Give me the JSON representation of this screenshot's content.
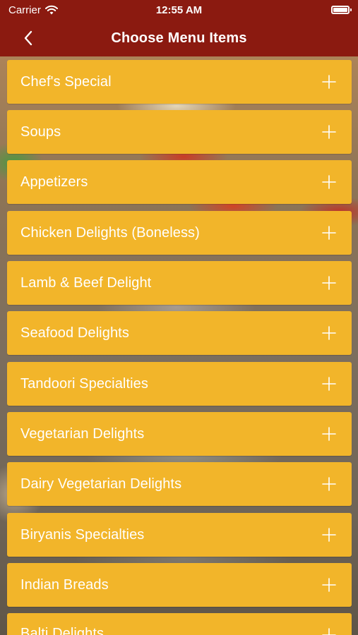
{
  "status_bar": {
    "carrier": "Carrier",
    "time": "12:55 AM"
  },
  "nav": {
    "title": "Choose Menu Items",
    "back_icon": "chevron-left-icon"
  },
  "colors": {
    "nav_background": "#8b1a10",
    "item_background": "#f2b52a",
    "item_text": "#ffffff"
  },
  "menu": {
    "items": [
      {
        "label": "Chef's Special"
      },
      {
        "label": "Soups"
      },
      {
        "label": "Appetizers"
      },
      {
        "label": "Chicken Delights (Boneless)"
      },
      {
        "label": "Lamb & Beef Delight"
      },
      {
        "label": "Seafood Delights"
      },
      {
        "label": "Tandoori Specialties"
      },
      {
        "label": "Vegetarian Delights"
      },
      {
        "label": "Dairy Vegetarian Delights"
      },
      {
        "label": "Biryanis Specialties"
      },
      {
        "label": "Indian Breads"
      },
      {
        "label": "Balti Delights"
      }
    ],
    "expand_icon": "plus-icon"
  }
}
